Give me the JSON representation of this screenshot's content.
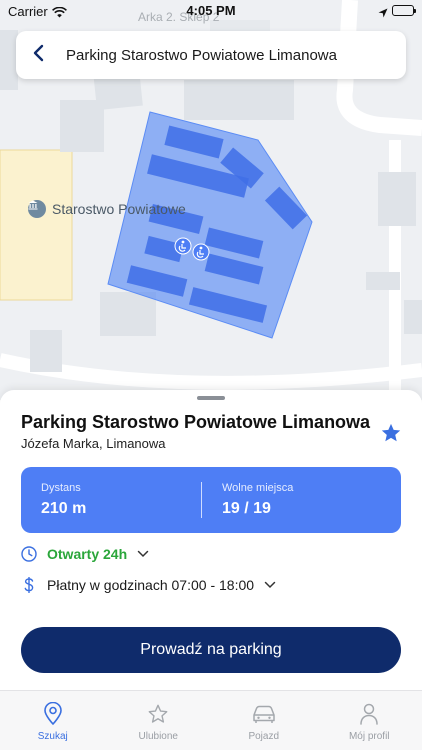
{
  "status_bar": {
    "carrier": "Carrier",
    "time": "4:05 PM"
  },
  "map": {
    "street_label": "Arka 2. Sklep 2",
    "poi_label": "Starostwo Powiatowe",
    "colors": {
      "parking_area": "#5b8cf5",
      "building": "#dfe3e8",
      "highlight_building": "#fbf2cf"
    }
  },
  "top_bar": {
    "title": "Parking Starostwo Powiatowe Limanowa",
    "back_icon": "chevron-left-icon"
  },
  "sheet": {
    "title": "Parking Starostwo Powiatowe Limanowa",
    "address": "Józefa Marka, Limanowa",
    "favorite_icon": "star-icon",
    "info": {
      "distance_label": "Dystans",
      "distance_value": "210 m",
      "free_label": "Wolne miejsca",
      "free_value": "19 / 19"
    },
    "open_text": "Otwarty 24h",
    "paid_text": "Płatny w godzinach 07:00 - 18:00",
    "navigate_button": "Prowadź na parking",
    "colors": {
      "card": "#4e7ef5",
      "open": "#2aa63a",
      "button": "#0f2b6b"
    }
  },
  "tabs": [
    {
      "label": "Szukaj",
      "icon": "location-pin-icon",
      "active": true
    },
    {
      "label": "Ulubione",
      "icon": "star-outline-icon",
      "active": false
    },
    {
      "label": "Pojazd",
      "icon": "car-icon",
      "active": false
    },
    {
      "label": "Mój profil",
      "icon": "person-icon",
      "active": false
    }
  ]
}
